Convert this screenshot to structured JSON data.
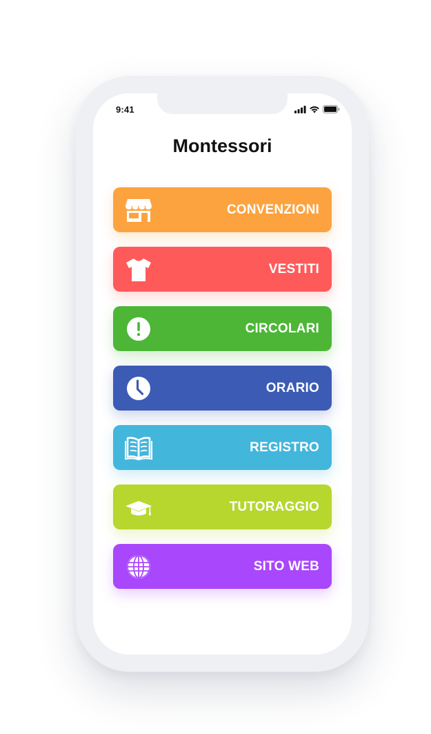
{
  "status_bar": {
    "time": "9:41",
    "icons": [
      "signal-icon",
      "wifi-icon",
      "battery-icon"
    ]
  },
  "app": {
    "title": "Montessori"
  },
  "menu": {
    "items": [
      {
        "label": "CONVENZIONI",
        "icon": "store-icon",
        "color": "#fca340"
      },
      {
        "label": "VESTITI",
        "icon": "tshirt-icon",
        "color": "#ff5a5a"
      },
      {
        "label": "CIRCOLARI",
        "icon": "exclamation-icon",
        "color": "#4db637"
      },
      {
        "label": "ORARIO",
        "icon": "clock-icon",
        "color": "#3b5bb5"
      },
      {
        "label": "REGISTRO",
        "icon": "book-icon",
        "color": "#43b6dc"
      },
      {
        "label": "TUTORAGGIO",
        "icon": "graduation-cap-icon",
        "color": "#b7d62e"
      },
      {
        "label": "SITO WEB",
        "icon": "globe-icon",
        "color": "#a847fc"
      }
    ]
  }
}
